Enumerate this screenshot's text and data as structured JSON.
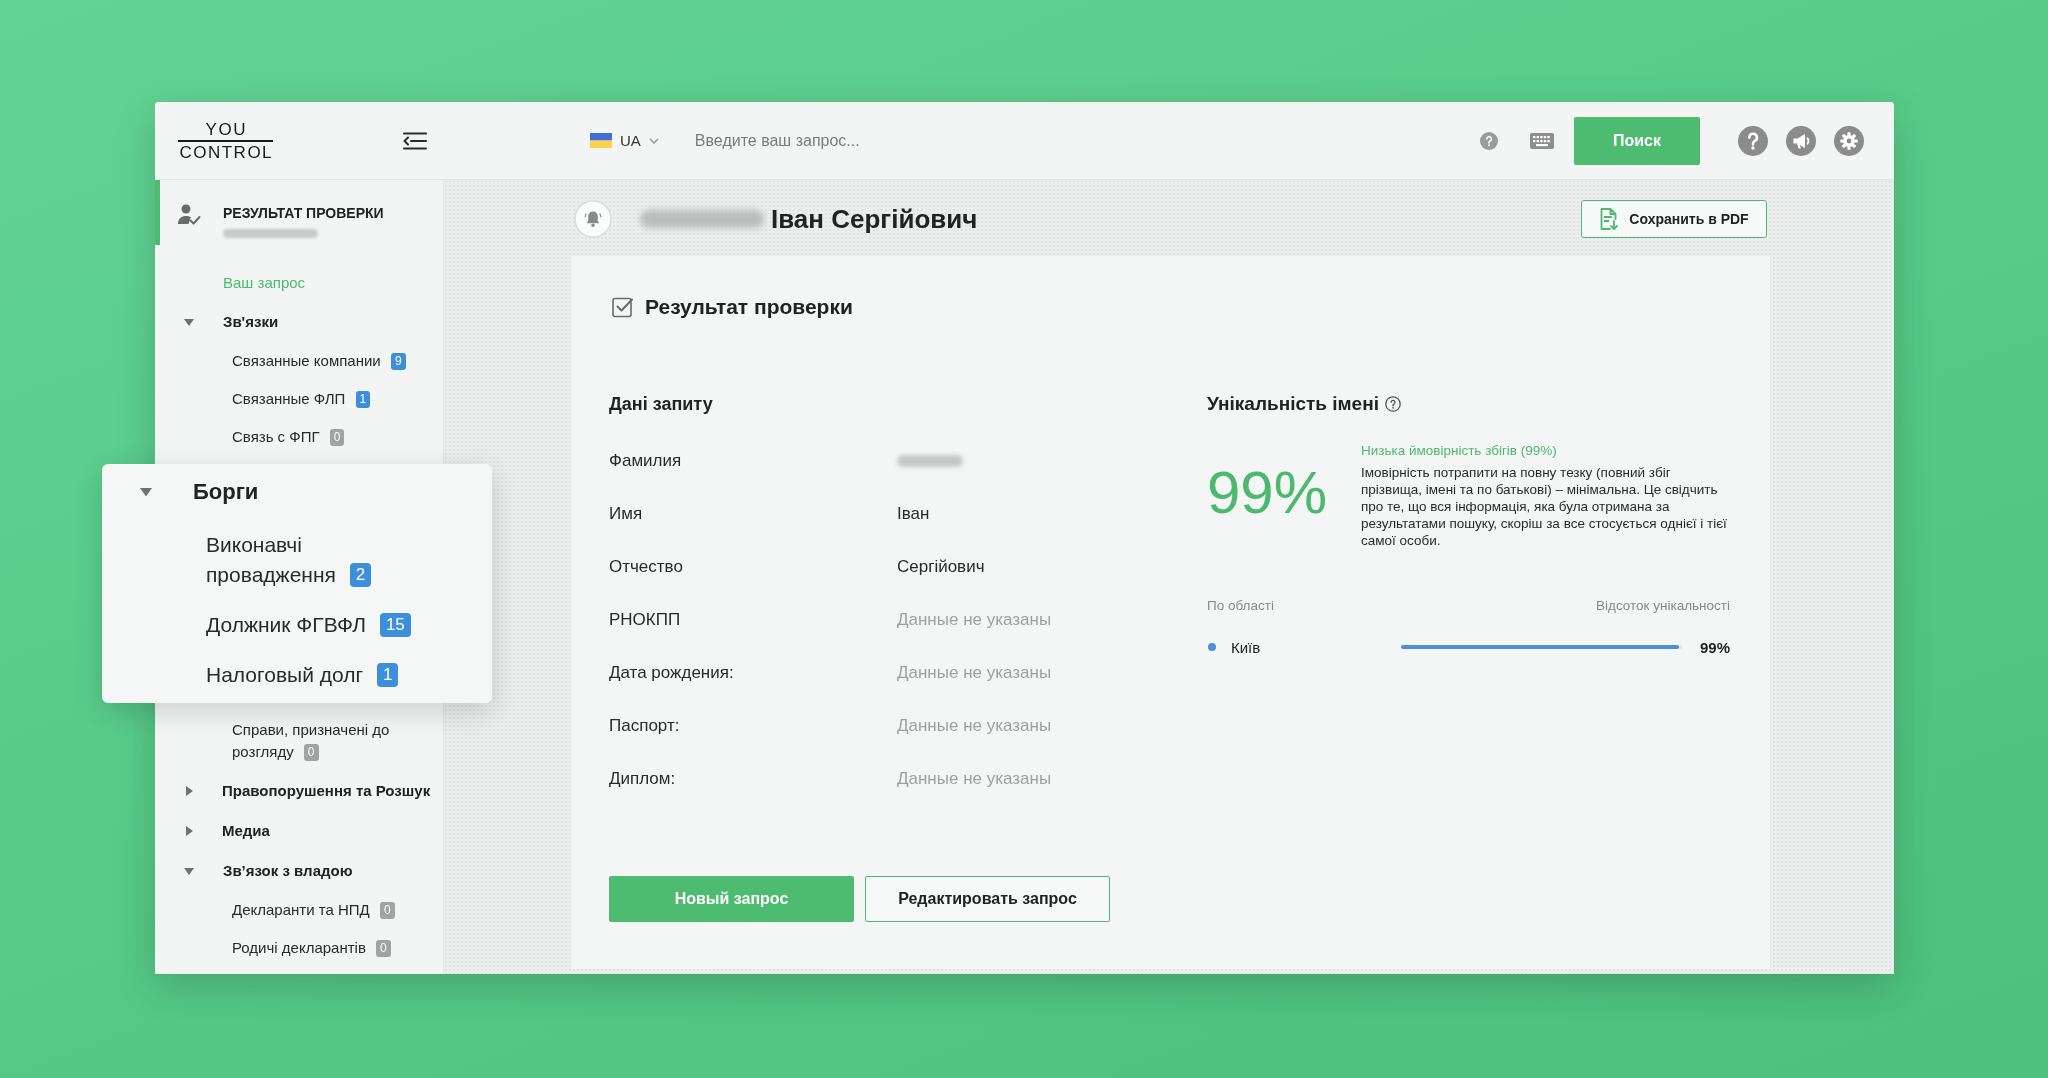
{
  "header": {
    "logo": {
      "top": "YOU",
      "bottom": "CONTROL"
    },
    "language": "UA",
    "search": {
      "placeholder": "Введите ваш запрос...",
      "button": "Поиск"
    }
  },
  "sidebar": {
    "header": {
      "title": "РЕЗУЛЬТАТ ПРОВЕРКИ",
      "subtitle_redacted": true,
      "selected": true
    },
    "items": [
      {
        "kind": "link",
        "label": "Ваш запрос"
      },
      {
        "kind": "group",
        "label": "Зв'язки",
        "expanded": true,
        "children": [
          {
            "label": "Связанные компании",
            "count": "9",
            "color": "#3d8fdc"
          },
          {
            "label": "Связанные ФЛП",
            "count": "1",
            "color": "#3d8fdc"
          },
          {
            "label": "Связь с ФПГ",
            "count": "0",
            "color": "#a3a3a3"
          }
        ]
      },
      {
        "kind": "group",
        "label": "Борги",
        "expanded": true,
        "callout": true,
        "children": [
          {
            "label": "Виконавчі провадження",
            "count": "2",
            "color": "#3d8fdc"
          },
          {
            "label": "Должник ФГВФЛ",
            "count": "15",
            "color": "#3d8fdc"
          },
          {
            "label": "Налоговый долг",
            "count": "1",
            "color": "#3d8fdc"
          }
        ]
      },
      {
        "kind": "group",
        "children": [
          {
            "label": "Справи, призначені до розгляду",
            "count": "0",
            "color": "#a3a3a3"
          }
        ]
      },
      {
        "kind": "group",
        "label": "Правопорушення та Розшук",
        "expanded": false
      },
      {
        "kind": "group",
        "label": "Медиа",
        "expanded": false
      },
      {
        "kind": "group",
        "label": "Зв’язок з владою",
        "expanded": true,
        "children": [
          {
            "label": "Декларанти та НПД",
            "count": "0",
            "color": "#a3a3a3"
          },
          {
            "label": "Родичі декларантів",
            "count": "0",
            "color": "#a3a3a3"
          }
        ]
      }
    ]
  },
  "person": {
    "surname_redacted": true,
    "name": "Іван Сергійович",
    "save_button": "Сохранить в PDF"
  },
  "result": {
    "title": "Результат проверки",
    "request": {
      "title": "Дані запиту",
      "rows": [
        {
          "label": "Фамилия",
          "kind": "redacted"
        },
        {
          "label": "Имя",
          "value": "Іван",
          "kind": "filled"
        },
        {
          "label": "Отчество",
          "value": "Сергійович",
          "kind": "filled"
        },
        {
          "label": "РНОКПП",
          "value": "Данные не указаны",
          "kind": "empty"
        },
        {
          "label": "Дата рождения:",
          "value": "Данные не указаны",
          "kind": "empty"
        },
        {
          "label": "Паспорт:",
          "value": "Данные не указаны",
          "kind": "empty"
        },
        {
          "label": "Диплом:",
          "value": "Данные не указаны",
          "kind": "empty"
        }
      ]
    },
    "buttons": [
      {
        "label": "Новый запрос",
        "kind": "primary"
      },
      {
        "label": "Редактировать запрос",
        "kind": "secondary"
      }
    ]
  },
  "uniqueness": {
    "title": "Унікальність імені",
    "percent": "99%",
    "verdict": "Низька ймовірність збігів (99%)",
    "description": "Імовірність потрапити на повну тезку (повний збіг прізвища, імені та по батькові) – мінімальна. Це свідчить про те, що вся інформація, яка була отримана за результатами пошуку, скоріш за все стосується однієї і тієї самої особи.",
    "columns": [
      "По області",
      "Відсоток унікальності"
    ],
    "regions": [
      {
        "name": "Київ",
        "level": 0.99,
        "reading": "99%"
      }
    ]
  }
}
